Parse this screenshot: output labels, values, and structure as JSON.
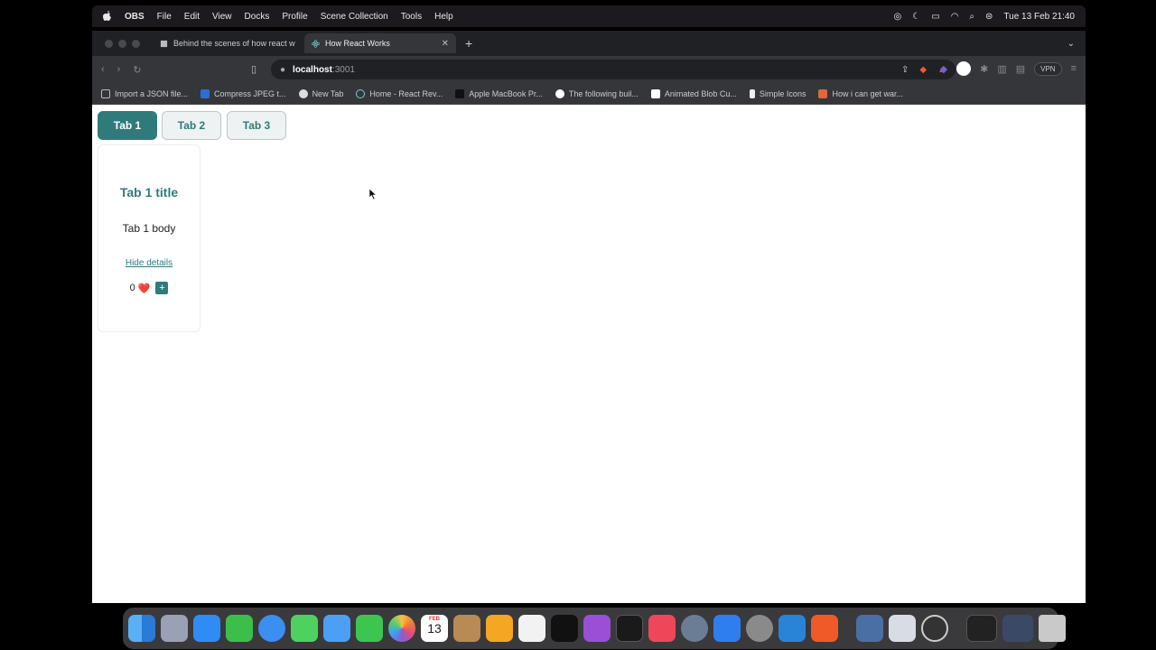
{
  "menubar": {
    "app": "OBS",
    "items": [
      "File",
      "Edit",
      "View",
      "Docks",
      "Profile",
      "Scene Collection",
      "Tools",
      "Help"
    ],
    "datetime": "Tue 13 Feb  21:40"
  },
  "browser": {
    "tabs": [
      {
        "label": "Behind the scenes of how react w",
        "active": false
      },
      {
        "label": "How React Works",
        "active": true
      }
    ],
    "address": {
      "host": "localhost",
      "port": ":3001"
    },
    "vpn_label": "VPN",
    "bookmarks": [
      "Import a JSON file...",
      "Compress JPEG t...",
      "New Tab",
      "Home - React Rev...",
      "Apple MacBook Pr...",
      "The following buil...",
      "Animated Blob Cu...",
      "Simple Icons",
      "How i can get war..."
    ]
  },
  "app": {
    "tabs": [
      {
        "label": "Tab 1",
        "active": true
      },
      {
        "label": "Tab 2",
        "active": false
      },
      {
        "label": "Tab 3",
        "active": false
      }
    ],
    "card": {
      "title": "Tab 1 title",
      "body": "Tab 1 body",
      "link": "Hide details",
      "count": "0",
      "heart": "❤️",
      "plus": "+"
    },
    "accent": "#2f7b7b"
  },
  "dock": {
    "calendar_month": "FEB",
    "calendar_day": "13"
  }
}
